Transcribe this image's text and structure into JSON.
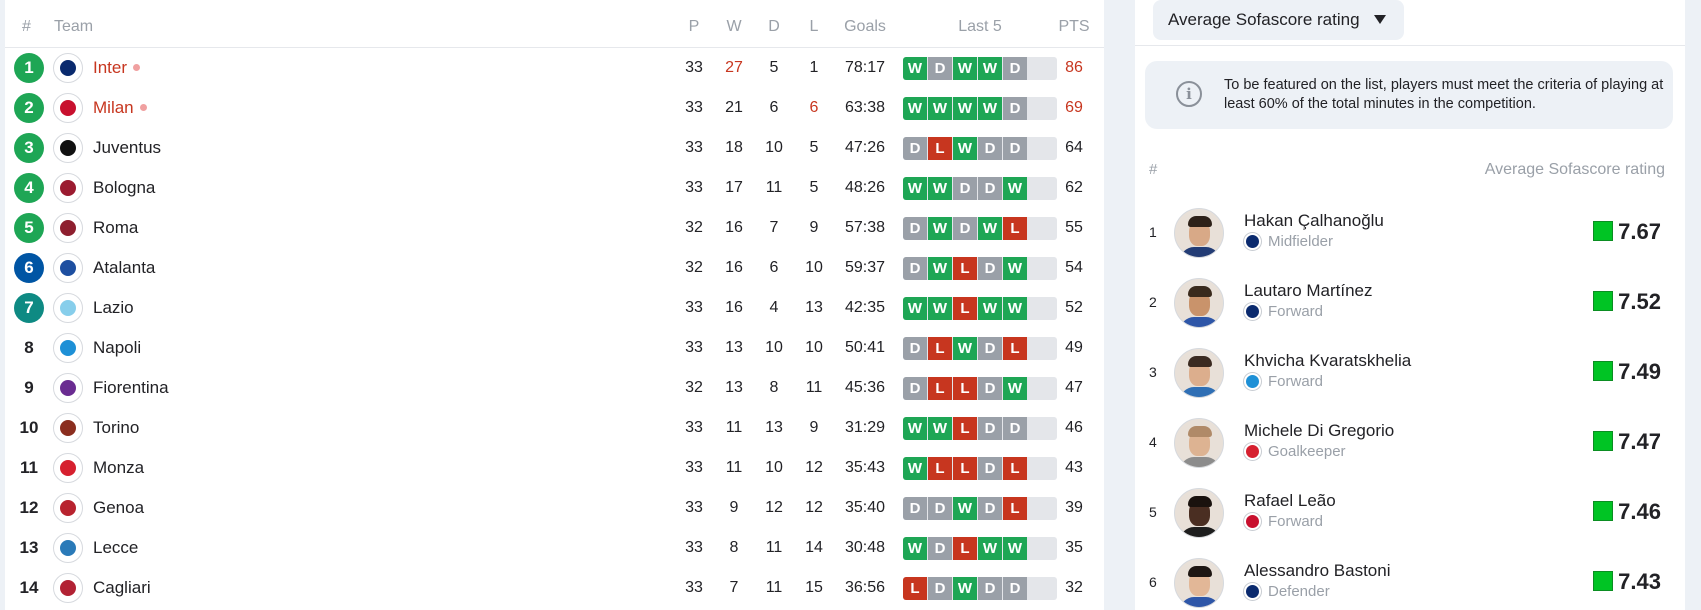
{
  "standings": {
    "headers": {
      "rank": "#",
      "team": "Team",
      "p": "P",
      "w": "W",
      "d": "D",
      "l": "L",
      "goals": "Goals",
      "last5": "Last 5",
      "pts": "PTS"
    },
    "rows": [
      {
        "rank": "1",
        "team": "Inter",
        "live": true,
        "p": "33",
        "w": "27",
        "d": "5",
        "l": "1",
        "goals": "78:17",
        "form": [
          "W",
          "D",
          "W",
          "W",
          "D"
        ],
        "pts": "86",
        "rank_color": "#1ea655",
        "crest_color": "#0a2a6e",
        "red_w": true,
        "red_pts": true
      },
      {
        "rank": "2",
        "team": "Milan",
        "live": true,
        "p": "33",
        "w": "21",
        "d": "6",
        "l": "6",
        "goals": "63:38",
        "form": [
          "W",
          "W",
          "W",
          "W",
          "D"
        ],
        "pts": "69",
        "rank_color": "#1ea655",
        "crest_color": "#c8102e",
        "red_l": true,
        "red_pts": true
      },
      {
        "rank": "3",
        "team": "Juventus",
        "p": "33",
        "w": "18",
        "d": "10",
        "l": "5",
        "goals": "47:26",
        "form": [
          "D",
          "L",
          "W",
          "D",
          "D"
        ],
        "pts": "64",
        "rank_color": "#1ea655",
        "crest_color": "#111111"
      },
      {
        "rank": "4",
        "team": "Bologna",
        "p": "33",
        "w": "17",
        "d": "11",
        "l": "5",
        "goals": "48:26",
        "form": [
          "W",
          "W",
          "D",
          "D",
          "W"
        ],
        "pts": "62",
        "rank_color": "#1ea655",
        "crest_color": "#9b1b30"
      },
      {
        "rank": "5",
        "team": "Roma",
        "p": "32",
        "w": "16",
        "d": "7",
        "l": "9",
        "goals": "57:38",
        "form": [
          "D",
          "W",
          "D",
          "W",
          "L"
        ],
        "pts": "55",
        "rank_color": "#1ea655",
        "crest_color": "#8e1f2f"
      },
      {
        "rank": "6",
        "team": "Atalanta",
        "p": "32",
        "w": "16",
        "d": "6",
        "l": "10",
        "goals": "59:37",
        "form": [
          "D",
          "W",
          "L",
          "D",
          "W"
        ],
        "pts": "54",
        "rank_color": "#0055a4",
        "crest_color": "#1e4fa0"
      },
      {
        "rank": "7",
        "team": "Lazio",
        "p": "33",
        "w": "16",
        "d": "4",
        "l": "13",
        "goals": "42:35",
        "form": [
          "W",
          "W",
          "L",
          "W",
          "W"
        ],
        "pts": "52",
        "rank_color": "#0e8a83",
        "crest_color": "#87ceeb"
      },
      {
        "rank": "8",
        "team": "Napoli",
        "p": "33",
        "w": "13",
        "d": "10",
        "l": "10",
        "goals": "50:41",
        "form": [
          "D",
          "L",
          "W",
          "D",
          "L"
        ],
        "pts": "49",
        "crest_color": "#1e90d6"
      },
      {
        "rank": "9",
        "team": "Fiorentina",
        "p": "32",
        "w": "13",
        "d": "8",
        "l": "11",
        "goals": "45:36",
        "form": [
          "D",
          "L",
          "L",
          "D",
          "W"
        ],
        "pts": "47",
        "crest_color": "#6a2c91"
      },
      {
        "rank": "10",
        "team": "Torino",
        "p": "33",
        "w": "11",
        "d": "13",
        "l": "9",
        "goals": "31:29",
        "form": [
          "W",
          "W",
          "L",
          "D",
          "D"
        ],
        "pts": "46",
        "crest_color": "#8b2e1f"
      },
      {
        "rank": "11",
        "team": "Monza",
        "p": "33",
        "w": "11",
        "d": "10",
        "l": "12",
        "goals": "35:43",
        "form": [
          "W",
          "L",
          "L",
          "D",
          "L"
        ],
        "pts": "43",
        "crest_color": "#d6202f"
      },
      {
        "rank": "12",
        "team": "Genoa",
        "p": "33",
        "w": "9",
        "d": "12",
        "l": "12",
        "goals": "35:40",
        "form": [
          "D",
          "D",
          "W",
          "D",
          "L"
        ],
        "pts": "39",
        "crest_color": "#b8232f"
      },
      {
        "rank": "13",
        "team": "Lecce",
        "p": "33",
        "w": "8",
        "d": "11",
        "l": "14",
        "goals": "30:48",
        "form": [
          "W",
          "D",
          "L",
          "W",
          "W"
        ],
        "pts": "35",
        "crest_color": "#2a7ab8"
      },
      {
        "rank": "14",
        "team": "Cagliari",
        "p": "33",
        "w": "7",
        "d": "11",
        "l": "15",
        "goals": "36:56",
        "form": [
          "L",
          "D",
          "W",
          "D",
          "D"
        ],
        "pts": "32",
        "crest_color": "#b22234"
      }
    ]
  },
  "ratings": {
    "selector_label": "Average Sofascore rating",
    "info_icon": "info-icon",
    "info_text": "To be featured on the list, players must meet the criteria of playing at least 60% of the total minutes in the competition.",
    "header_rank": "#",
    "header_title": "Average Sofascore rating",
    "players": [
      {
        "rank": "1",
        "name": "Hakan Çalhanoğlu",
        "position": "Midfielder",
        "rating": "7.67",
        "club_color": "#0a2a6e",
        "hair": "#2e2118",
        "skin": "#d8a987",
        "shirt": "#233c75"
      },
      {
        "rank": "2",
        "name": "Lautaro Martínez",
        "position": "Forward",
        "rating": "7.52",
        "club_color": "#0a2a6e",
        "hair": "#3a2a1c",
        "skin": "#c9936b",
        "shirt": "#2e56a8"
      },
      {
        "rank": "3",
        "name": "Khvicha Kvaratskhelia",
        "position": "Forward",
        "rating": "7.49",
        "club_color": "#1e90d6",
        "hair": "#3b2a20",
        "skin": "#dcae8d",
        "shirt": "#2f6fb5"
      },
      {
        "rank": "4",
        "name": "Michele Di Gregorio",
        "position": "Goalkeeper",
        "rating": "7.47",
        "club_color": "#d6202f",
        "hair": "#b08a68",
        "skin": "#ddb392",
        "shirt": "#8c8c8c"
      },
      {
        "rank": "5",
        "name": "Rafael Leão",
        "position": "Forward",
        "rating": "7.46",
        "club_color": "#c8102e",
        "hair": "#1a120e",
        "skin": "#4a2e22",
        "shirt": "#1e1e1e"
      },
      {
        "rank": "6",
        "name": "Alessandro Bastoni",
        "position": "Defender",
        "rating": "7.43",
        "club_color": "#0a2a6e",
        "hair": "#1e1612",
        "skin": "#e2b797",
        "shirt": "#2e56a8"
      }
    ],
    "rating_color": "#00c424"
  }
}
